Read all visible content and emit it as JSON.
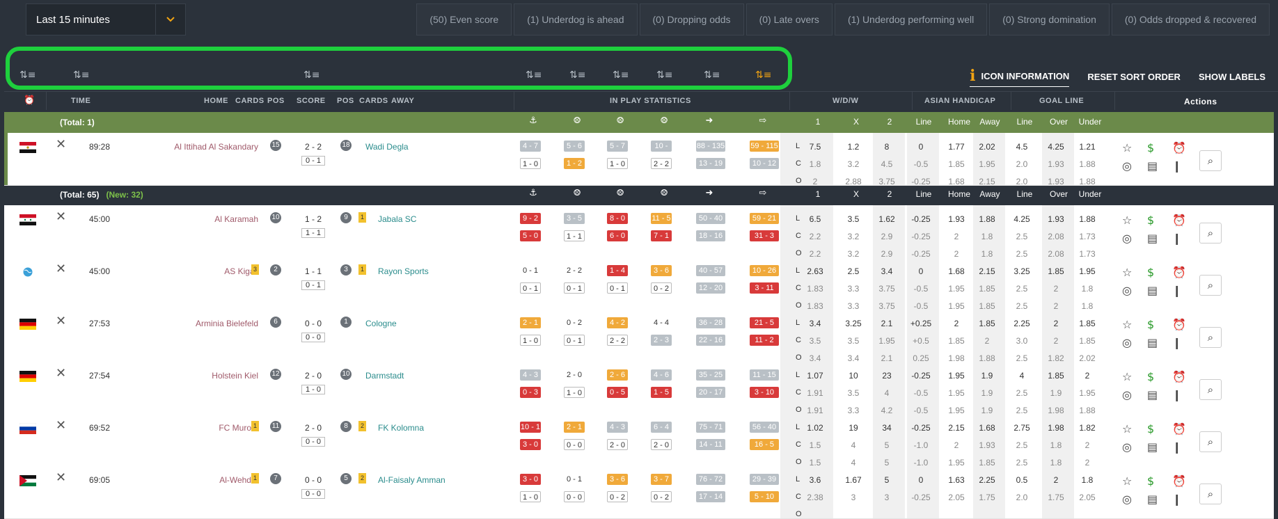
{
  "time_filter": {
    "label": "Last 15 minutes"
  },
  "filters": [
    "(50) Even score",
    "(1) Underdog is ahead",
    "(0) Dropping odds",
    "(0) Late overs",
    "(1) Underdog performing well",
    "(0) Strong domination",
    "(0) Odds dropped & recovered"
  ],
  "top_links": {
    "icon_info": "ICON INFORMATION",
    "reset_sort": "RESET SORT ORDER",
    "show_labels": "SHOW LABELS",
    "info_glyph": "i"
  },
  "sort_glyph": "⇅≡",
  "header": {
    "time": "TIME",
    "home": "HOME",
    "cards": "CARDS",
    "pos": "POS",
    "score": "SCORE",
    "pos2": "POS",
    "cards2": "CARDS",
    "away": "AWAY",
    "inplay": "IN PLAY STATISTICS",
    "wdw": "W/D/W",
    "ah": "ASIAN HANDICAP",
    "gl": "GOAL LINE",
    "actions": "Actions"
  },
  "odds_headers": [
    "1",
    "X",
    "2",
    "Line",
    "Home",
    "Away",
    "Line",
    "Over",
    "Under"
  ],
  "groups": [
    {
      "total": "(Total: 1)",
      "new": ""
    },
    {
      "total": "(Total: 65)",
      "new": "(New: 32)"
    }
  ],
  "line_codes": [
    "L",
    "C",
    "O"
  ],
  "matches": [
    {
      "flag": "egypt",
      "time": "89:28",
      "home": "Al Ittihad Al Sakandary",
      "home_cards": "",
      "home_pos": "15",
      "score": "2 - 2",
      "ht": "0 - 1",
      "away_pos": "18",
      "away_cards": "",
      "away": "Wadi Degla",
      "stats_top": [
        [
          "4 - 7",
          "gry"
        ],
        [
          "5 - 6",
          "gry"
        ],
        [
          "5 - 7",
          "gry"
        ],
        [
          "10 - 13",
          "gry"
        ],
        [
          "88 - 135",
          "gry"
        ],
        [
          "59 - 115",
          "org"
        ]
      ],
      "stats_bot": [
        [
          "1 - 0",
          "wht"
        ],
        [
          "1 - 2",
          "org"
        ],
        [
          "1 - 0",
          "wht"
        ],
        [
          "2 - 2",
          "wht"
        ],
        [
          "13 - 19",
          "gry"
        ],
        [
          "10 - 12",
          "gry"
        ]
      ],
      "odds": [
        [
          "7.5",
          "1.2",
          "8",
          "0",
          "1.77",
          "2.02",
          "4.5",
          "4.25",
          "1.21"
        ],
        [
          "1.8",
          "3.2",
          "4.5",
          "-0.5",
          "1.85",
          "1.95",
          "2.0",
          "1.93",
          "1.88"
        ],
        [
          "2",
          "2.88",
          "3.75",
          "-0.25",
          "1.68",
          "2.15",
          "2.0",
          "1.93",
          "1.88"
        ]
      ]
    },
    {
      "flag": "syria",
      "time": "45:00",
      "home": "Al Karamah",
      "home_cards": "",
      "home_pos": "10",
      "score": "1 - 2",
      "ht": "1 - 1",
      "away_pos": "9",
      "away_cards": "1",
      "away": "Jabala SC",
      "stats_top": [
        [
          "9 - 2",
          "red"
        ],
        [
          "3 - 5",
          "gry"
        ],
        [
          "8 - 0",
          "red"
        ],
        [
          "11 - 5",
          "org"
        ],
        [
          "50 - 40",
          "gry"
        ],
        [
          "59 - 21",
          "org"
        ]
      ],
      "stats_bot": [
        [
          "5 - 0",
          "red"
        ],
        [
          "1 - 1",
          "wht"
        ],
        [
          "6 - 0",
          "red"
        ],
        [
          "7 - 1",
          "red"
        ],
        [
          "18 - 16",
          "gry"
        ],
        [
          "31 - 3",
          "red"
        ]
      ],
      "odds": [
        [
          "6.5",
          "3.5",
          "1.62",
          "-0.25",
          "1.93",
          "1.88",
          "4.25",
          "1.93",
          "1.88"
        ],
        [
          "2.2",
          "3.2",
          "2.9",
          "-0.25",
          "2",
          "1.8",
          "2.5",
          "2.08",
          "1.73"
        ],
        [
          "2.2",
          "3.2",
          "2.9",
          "-0.25",
          "2",
          "1.8",
          "2.5",
          "2.08",
          "1.73"
        ]
      ]
    },
    {
      "flag": "world",
      "time": "45:00",
      "home": "AS Kigali",
      "home_cards": "3",
      "home_pos": "2",
      "score": "1 - 1",
      "ht": "0 - 1",
      "away_pos": "3",
      "away_cards": "1",
      "away": "Rayon Sports",
      "stats_top": [
        [
          "0 - 1",
          "plain"
        ],
        [
          "2 - 2",
          "plain"
        ],
        [
          "1 - 4",
          "red"
        ],
        [
          "3 - 6",
          "org"
        ],
        [
          "40 - 57",
          "gry"
        ],
        [
          "10 - 26",
          "org"
        ]
      ],
      "stats_bot": [
        [
          "0 - 1",
          "wht"
        ],
        [
          "0 - 1",
          "wht"
        ],
        [
          "0 - 1",
          "wht"
        ],
        [
          "0 - 2",
          "wht"
        ],
        [
          "12 - 20",
          "gry"
        ],
        [
          "3 - 11",
          "red"
        ]
      ],
      "odds": [
        [
          "2.63",
          "2.5",
          "3.4",
          "0",
          "1.68",
          "2.15",
          "3.25",
          "1.85",
          "1.95"
        ],
        [
          "1.83",
          "3.3",
          "3.75",
          "-0.5",
          "1.95",
          "1.85",
          "2.5",
          "2",
          "1.8"
        ],
        [
          "1.83",
          "3.3",
          "3.75",
          "-0.5",
          "1.95",
          "1.85",
          "2.5",
          "2",
          "1.8"
        ]
      ]
    },
    {
      "flag": "germany",
      "time": "27:53",
      "home": "Arminia Bielefeld",
      "home_cards": "",
      "home_pos": "6",
      "score": "0 - 0",
      "ht": "0 - 0",
      "away_pos": "1",
      "away_cards": "",
      "away": "Cologne",
      "stats_top": [
        [
          "2 - 1",
          "org"
        ],
        [
          "0 - 2",
          "plain"
        ],
        [
          "4 - 2",
          "org"
        ],
        [
          "4 - 4",
          "plain"
        ],
        [
          "36 - 28",
          "gry"
        ],
        [
          "21 - 5",
          "red"
        ]
      ],
      "stats_bot": [
        [
          "1 - 0",
          "wht"
        ],
        [
          "0 - 1",
          "wht"
        ],
        [
          "2 - 2",
          "wht"
        ],
        [
          "2 - 3",
          "gry"
        ],
        [
          "22 - 16",
          "gry"
        ],
        [
          "11 - 2",
          "red"
        ]
      ],
      "odds": [
        [
          "3.4",
          "3.25",
          "2.1",
          "+0.25",
          "2",
          "1.85",
          "2.25",
          "2",
          "1.85"
        ],
        [
          "3.5",
          "3.5",
          "1.95",
          "+0.5",
          "1.85",
          "2",
          "3.0",
          "2",
          "1.85"
        ],
        [
          "3.4",
          "3.4",
          "2.1",
          "0.25",
          "1.98",
          "1.88",
          "2.5",
          "1.82",
          "2.02"
        ]
      ]
    },
    {
      "flag": "germany",
      "time": "27:54",
      "home": "Holstein Kiel",
      "home_cards": "",
      "home_pos": "12",
      "score": "2 - 0",
      "ht": "1 - 0",
      "away_pos": "10",
      "away_cards": "",
      "away": "Darmstadt",
      "stats_top": [
        [
          "4 - 3",
          "gry"
        ],
        [
          "2 - 0",
          "plain"
        ],
        [
          "2 - 6",
          "org"
        ],
        [
          "4 - 6",
          "gry"
        ],
        [
          "35 - 25",
          "gry"
        ],
        [
          "11 - 15",
          "gry"
        ]
      ],
      "stats_bot": [
        [
          "0 - 3",
          "red"
        ],
        [
          "1 - 0",
          "wht"
        ],
        [
          "0 - 5",
          "red"
        ],
        [
          "1 - 5",
          "red"
        ],
        [
          "20 - 17",
          "gry"
        ],
        [
          "3 - 10",
          "red"
        ]
      ],
      "odds": [
        [
          "1.07",
          "10",
          "23",
          "-0.25",
          "1.95",
          "1.9",
          "4",
          "1.85",
          "2"
        ],
        [
          "1.91",
          "3.5",
          "4",
          "-0.5",
          "1.95",
          "1.9",
          "2.5",
          "1.9",
          "1.95"
        ],
        [
          "1.91",
          "3.3",
          "4.2",
          "-0.5",
          "1.95",
          "1.9",
          "2.5",
          "1.98",
          "1.88"
        ]
      ]
    },
    {
      "flag": "russia",
      "time": "69:52",
      "home": "FC Murom",
      "home_cards": "1",
      "home_pos": "11",
      "score": "2 - 0",
      "ht": "0 - 0",
      "away_pos": "8",
      "away_cards": "2",
      "away": "FK Kolomna",
      "stats_top": [
        [
          "10 - 1",
          "red"
        ],
        [
          "2 - 1",
          "org"
        ],
        [
          "4 - 3",
          "gry"
        ],
        [
          "6 - 4",
          "gry"
        ],
        [
          "75 - 71",
          "gry"
        ],
        [
          "56 - 40",
          "gry"
        ]
      ],
      "stats_bot": [
        [
          "3 - 0",
          "red"
        ],
        [
          "0 - 0",
          "wht"
        ],
        [
          "2 - 0",
          "wht"
        ],
        [
          "2 - 0",
          "wht"
        ],
        [
          "14 - 11",
          "gry"
        ],
        [
          "16 - 5",
          "org"
        ]
      ],
      "odds": [
        [
          "1.02",
          "19",
          "34",
          "-0.25",
          "2.15",
          "1.68",
          "2.75",
          "1.98",
          "1.82"
        ],
        [
          "1.5",
          "4",
          "5",
          "-1.0",
          "2",
          "1.93",
          "2.5",
          "1.8",
          "2"
        ],
        [
          "1.5",
          "4",
          "5",
          "-1.0",
          "1.95",
          "1.85",
          "2.5",
          "1.8",
          "2"
        ]
      ]
    },
    {
      "flag": "jordan",
      "time": "69:05",
      "home": "Al-Wehdat",
      "home_cards": "1",
      "home_pos": "7",
      "score": "0 - 0",
      "ht": "0 - 0",
      "away_pos": "5",
      "away_cards": "2",
      "away": "Al-Faisaly Amman",
      "stats_top": [
        [
          "3 - 0",
          "red"
        ],
        [
          "0 - 1",
          "plain"
        ],
        [
          "3 - 6",
          "org"
        ],
        [
          "3 - 7",
          "org"
        ],
        [
          "76 - 72",
          "gry"
        ],
        [
          "29 - 39",
          "gry"
        ]
      ],
      "stats_bot": [
        [
          "1 - 0",
          "wht"
        ],
        [
          "0 - 0",
          "wht"
        ],
        [
          "0 - 2",
          "wht"
        ],
        [
          "0 - 2",
          "wht"
        ],
        [
          "17 - 14",
          "gry"
        ],
        [
          "5 - 10",
          "org"
        ]
      ],
      "odds": [
        [
          "3.6",
          "1.67",
          "5",
          "0",
          "1.63",
          "2.25",
          "0.5",
          "2",
          "1.8"
        ],
        [
          "2.38",
          "3",
          "3",
          "-0.25",
          "2.05",
          "1.75",
          "2.0",
          "1.75",
          "2.05"
        ],
        [
          "",
          "",
          "",
          "",
          "",
          "",
          "",
          "",
          ""
        ]
      ]
    }
  ]
}
